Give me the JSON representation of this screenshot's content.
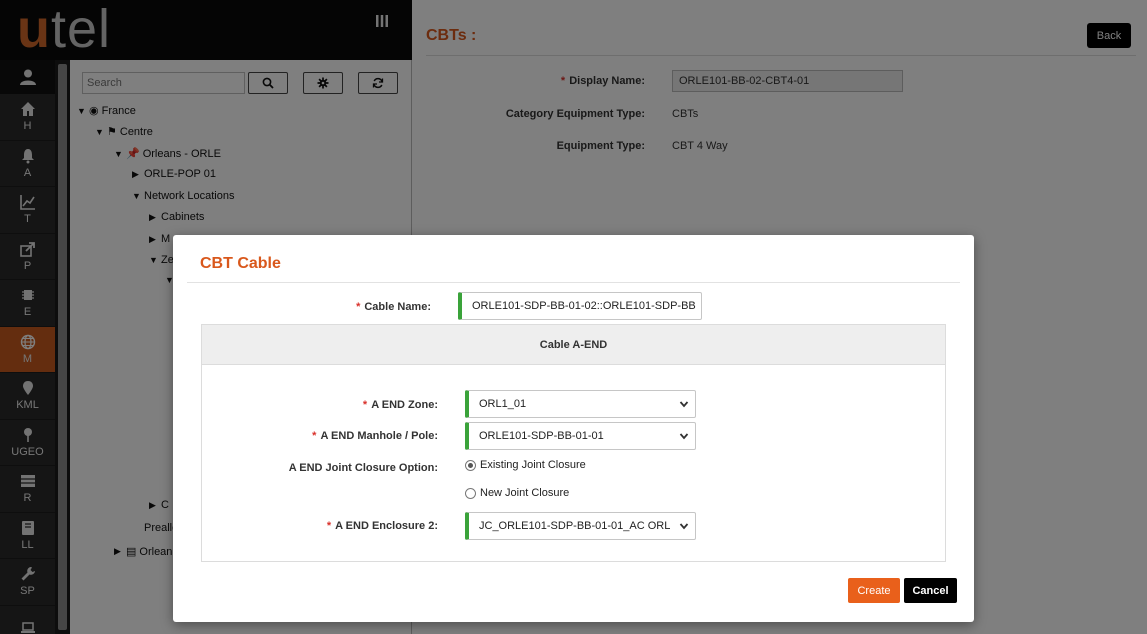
{
  "brand": {
    "logo_first": "u",
    "logo_rest": "tel",
    "menu_toggle": "|||"
  },
  "rail": {
    "items": [
      {
        "label": "H",
        "icon": "home-icon"
      },
      {
        "label": "A",
        "icon": "bell-icon"
      },
      {
        "label": "T",
        "icon": "chart-line-icon"
      },
      {
        "label": "P",
        "icon": "share-icon"
      },
      {
        "label": "E",
        "icon": "chip-icon"
      },
      {
        "label": "M",
        "icon": "globe-icon",
        "active": true
      },
      {
        "label": "KML",
        "icon": "map-pin-icon"
      },
      {
        "label": "UGEO",
        "icon": "pushpin-icon"
      },
      {
        "label": "R",
        "icon": "list-icon"
      },
      {
        "label": "LL",
        "icon": "book-icon"
      },
      {
        "label": "SP",
        "icon": "wrench-icon"
      },
      {
        "label": "",
        "icon": "laptop-icon"
      }
    ]
  },
  "tree": {
    "search_placeholder": "Search",
    "nodes": {
      "france": "France",
      "centre": "Centre",
      "orleans": "Orleans - ORLE",
      "pop": "ORLE-POP 01",
      "netloc": "Network Locations",
      "cabinets": "Cabinets",
      "m": "M",
      "ze": "Ze",
      "c": "C",
      "prealloc": "Prealle",
      "orleans2": "Orlean"
    }
  },
  "page": {
    "title": "CBTs :",
    "back_label": "Back",
    "display_name_label": "Display Name:",
    "display_name_value": "ORLE101-BB-02-CBT4-01",
    "category_label": "Category Equipment Type:",
    "category_value": "CBTs",
    "equipment_label": "Equipment Type:",
    "equipment_value": "CBT 4 Way"
  },
  "modal": {
    "title": "CBT Cable",
    "required_marker": "*",
    "cable_name_label": "Cable Name:",
    "cable_name_value": "ORLE101-SDP-BB-01-02::ORLE101-SDP-BB",
    "section_title": "Cable A-END",
    "zone_label": "A END Zone:",
    "zone_value": "ORL1_01",
    "manhole_label": "A END Manhole / Pole:",
    "manhole_value": "ORLE101-SDP-BB-01-01",
    "joint_label": "A END Joint Closure Option:",
    "joint_option_existing": "Existing Joint Closure",
    "joint_option_new": "New Joint Closure",
    "joint_selected": "existing",
    "enclosure_label": "A END Enclosure 2:",
    "enclosure_value": "JC_ORLE101-SDP-BB-01-01_AC ORL",
    "create_label": "Create",
    "cancel_label": "Cancel"
  },
  "colors": {
    "accent": "#d9581c",
    "valid_border": "#3aa33a",
    "rail_active": "#c85b1e",
    "required": "#d9302a"
  }
}
